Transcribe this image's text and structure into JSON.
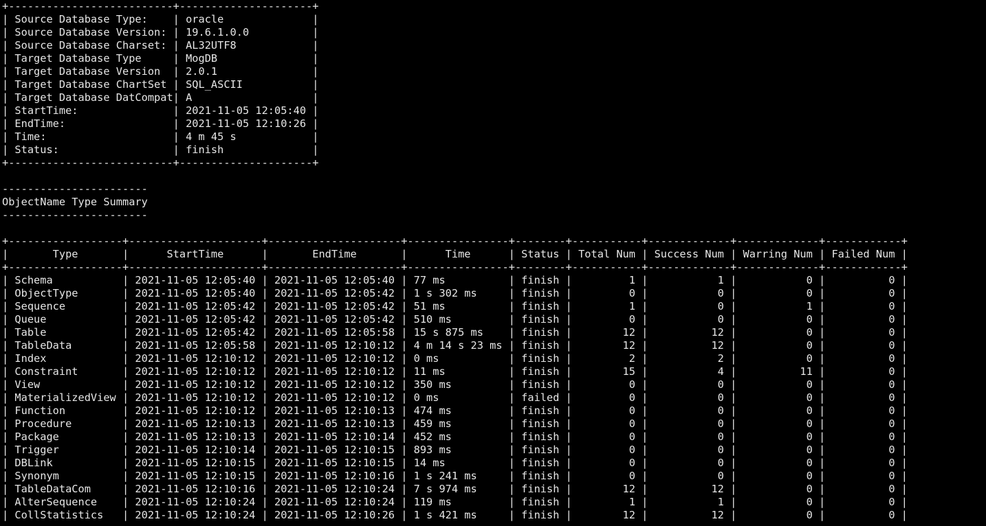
{
  "terminal": {
    "lines": [
      "+--------------------------+---------------------+",
      "| Source Database Type:    | oracle              |",
      "| Source Database Version: | 19.6.1.0.0          |",
      "| Source Database Charset: | AL32UTF8            |",
      "| Target Database Type     | MogDB               |",
      "| Target Database Version  | 2.0.1               |",
      "| Target Database ChartSet | SQL_ASCII           |",
      "| Target Database DatCompat| A                   |",
      "| StartTime:               | 2021-11-05 12:05:40 |",
      "| EndTime:                 | 2021-11-05 12:10:26 |",
      "| Time:                    | 4 m 45 s            |",
      "| Status:                  | finish              |",
      "+--------------------------+---------------------+",
      "",
      "-----------------------",
      "ObjectName Type Summary",
      "-----------------------",
      "",
      "+------------------+---------------------+---------------------+----------------+--------+-----------+-------------+-------------+------------+",
      "|       Type       |      StartTime      |       EndTime       |      Time      | Status | Total Num | Success Num | Warring Num | Failed Num |",
      "+------------------+---------------------+---------------------+----------------+--------+-----------+-------------+-------------+------------+",
      "| Schema           | 2021-11-05 12:05:40 | 2021-11-05 12:05:40 | 77 ms          | finish |         1 |           1 |           0 |          0 |",
      "| ObjectType       | 2021-11-05 12:05:40 | 2021-11-05 12:05:42 | 1 s 302 ms     | finish |         0 |           0 |           0 |          0 |",
      "| Sequence         | 2021-11-05 12:05:42 | 2021-11-05 12:05:42 | 51 ms          | finish |         1 |           0 |           1 |          0 |",
      "| Queue            | 2021-11-05 12:05:42 | 2021-11-05 12:05:42 | 510 ms         | finish |         0 |           0 |           0 |          0 |",
      "| Table            | 2021-11-05 12:05:42 | 2021-11-05 12:05:58 | 15 s 875 ms    | finish |        12 |          12 |           0 |          0 |",
      "| TableData        | 2021-11-05 12:05:58 | 2021-11-05 12:10:12 | 4 m 14 s 23 ms | finish |        12 |          12 |           0 |          0 |",
      "| Index            | 2021-11-05 12:10:12 | 2021-11-05 12:10:12 | 0 ms           | finish |         2 |           2 |           0 |          0 |",
      "| Constraint       | 2021-11-05 12:10:12 | 2021-11-05 12:10:12 | 11 ms          | finish |        15 |           4 |          11 |          0 |",
      "| View             | 2021-11-05 12:10:12 | 2021-11-05 12:10:12 | 350 ms         | finish |         0 |           0 |           0 |          0 |",
      "| MaterializedView | 2021-11-05 12:10:12 | 2021-11-05 12:10:12 | 0 ms           | failed |         0 |           0 |           0 |          0 |",
      "| Function         | 2021-11-05 12:10:12 | 2021-11-05 12:10:13 | 474 ms         | finish |         0 |           0 |           0 |          0 |",
      "| Procedure        | 2021-11-05 12:10:13 | 2021-11-05 12:10:13 | 459 ms         | finish |         0 |           0 |           0 |          0 |",
      "| Package          | 2021-11-05 12:10:13 | 2021-11-05 12:10:14 | 452 ms         | finish |         0 |           0 |           0 |          0 |",
      "| Trigger          | 2021-11-05 12:10:14 | 2021-11-05 12:10:15 | 893 ms         | finish |         0 |           0 |           0 |          0 |",
      "| DBLink           | 2021-11-05 12:10:15 | 2021-11-05 12:10:15 | 14 ms          | finish |         0 |           0 |           0 |          0 |",
      "| Synonym          | 2021-11-05 12:10:15 | 2021-11-05 12:10:16 | 1 s 241 ms     | finish |         0 |           0 |           0 |          0 |",
      "| TableDataCom     | 2021-11-05 12:10:16 | 2021-11-05 12:10:24 | 7 s 974 ms     | finish |        12 |          12 |           0 |          0 |",
      "| AlterSequence    | 2021-11-05 12:10:24 | 2021-11-05 12:10:24 | 119 ms         | finish |         1 |           1 |           0 |          0 |",
      "| CollStatistics   | 2021-11-05 12:10:24 | 2021-11-05 12:10:26 | 1 s 421 ms     | finish |        12 |          12 |           0 |          0 |"
    ]
  }
}
